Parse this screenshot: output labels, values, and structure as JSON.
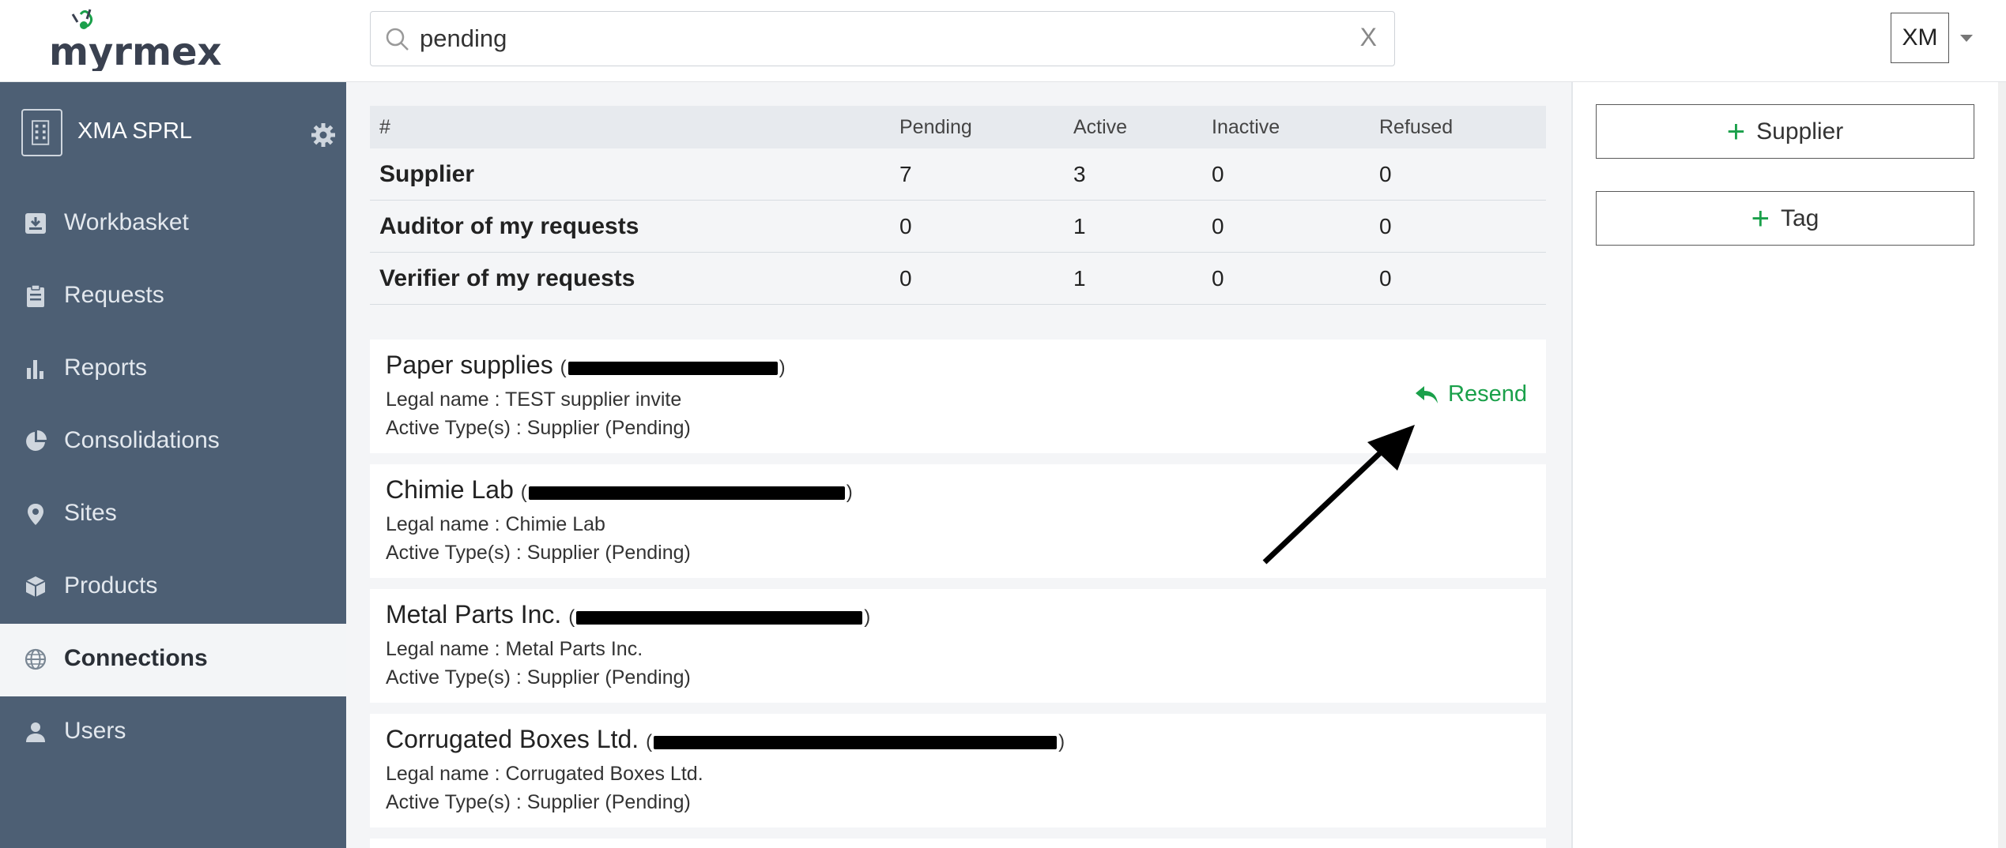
{
  "app": {
    "brand": "myrmex"
  },
  "search": {
    "value": "pending",
    "clear_label": "X"
  },
  "user": {
    "initials": "XM"
  },
  "sidebar": {
    "org_name": "XMA SPRL",
    "items": [
      {
        "label": "Workbasket",
        "icon": "inbox-download-icon"
      },
      {
        "label": "Requests",
        "icon": "clipboard-icon"
      },
      {
        "label": "Reports",
        "icon": "bar-chart-icon"
      },
      {
        "label": "Consolidations",
        "icon": "pie-chart-icon"
      },
      {
        "label": "Sites",
        "icon": "map-pin-icon"
      },
      {
        "label": "Products",
        "icon": "box-icon"
      },
      {
        "label": "Connections",
        "icon": "globe-icon",
        "active": true
      },
      {
        "label": "Users",
        "icon": "user-icon"
      }
    ]
  },
  "summary": {
    "headers": [
      "#",
      "Pending",
      "Active",
      "Inactive",
      "Refused"
    ],
    "rows": [
      [
        "Supplier",
        "7",
        "3",
        "0",
        "0"
      ],
      [
        "Auditor of my requests",
        "0",
        "1",
        "0",
        "0"
      ],
      [
        "Verifier of my requests",
        "0",
        "1",
        "0",
        "0"
      ]
    ]
  },
  "connections": [
    {
      "name": "Paper supplies",
      "legal": "Legal name : TEST supplier invite",
      "types": "Active Type(s) : Supplier (Pending)",
      "action": "Resend"
    },
    {
      "name": "Chimie Lab",
      "legal": "Legal name : Chimie Lab",
      "types": "Active Type(s) : Supplier (Pending)"
    },
    {
      "name": "Metal Parts Inc.",
      "legal": "Legal name : Metal Parts Inc.",
      "types": "Active Type(s) : Supplier (Pending)"
    },
    {
      "name": "Corrugated Boxes Ltd.",
      "legal": "Legal name : Corrugated Boxes Ltd.",
      "types": "Active Type(s) : Supplier (Pending)"
    }
  ],
  "actions": {
    "add_supplier": "Supplier",
    "add_tag": "Tag"
  },
  "colors": {
    "sidebar": "#4d5f74",
    "accent_green": "#1aa04a",
    "brand_dark": "#3a4150"
  }
}
